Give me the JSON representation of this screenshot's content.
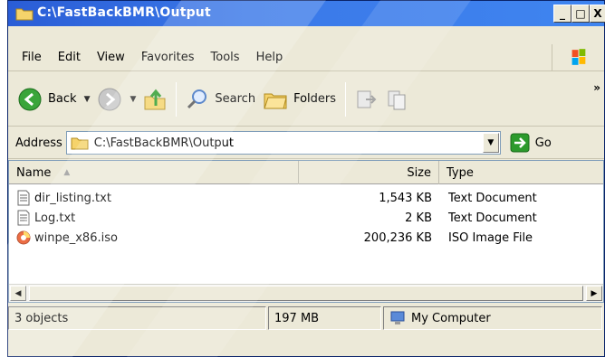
{
  "window": {
    "title": "C:\\FastBackBMR\\Output",
    "min_label": "_",
    "max_label": "□",
    "close_label": "X"
  },
  "menu": [
    "File",
    "Edit",
    "View",
    "Favorites",
    "Tools",
    "Help"
  ],
  "toolbar": {
    "back_label": "Back",
    "search_label": "Search",
    "folders_label": "Folders",
    "more_label": "»"
  },
  "address": {
    "label": "Address",
    "value": "C:\\FastBackBMR\\Output",
    "go_label": "Go"
  },
  "columns": {
    "name": "Name",
    "size": "Size",
    "type": "Type"
  },
  "files": [
    {
      "name": "dir_listing.txt",
      "size": "1,543 KB",
      "type": "Text Document",
      "icon": "text-file-icon"
    },
    {
      "name": "Log.txt",
      "size": "2 KB",
      "type": "Text Document",
      "icon": "text-file-icon"
    },
    {
      "name": "winpe_x86.iso",
      "size": "200,236 KB",
      "type": "ISO Image File",
      "icon": "iso-file-icon"
    }
  ],
  "status": {
    "objects": "3 objects",
    "size": "197 MB",
    "location": "My Computer"
  },
  "colors": {
    "title_bar": "#2a5dd6",
    "window_bg": "#ece9d8",
    "go_arrow": "#2c9a2c"
  }
}
